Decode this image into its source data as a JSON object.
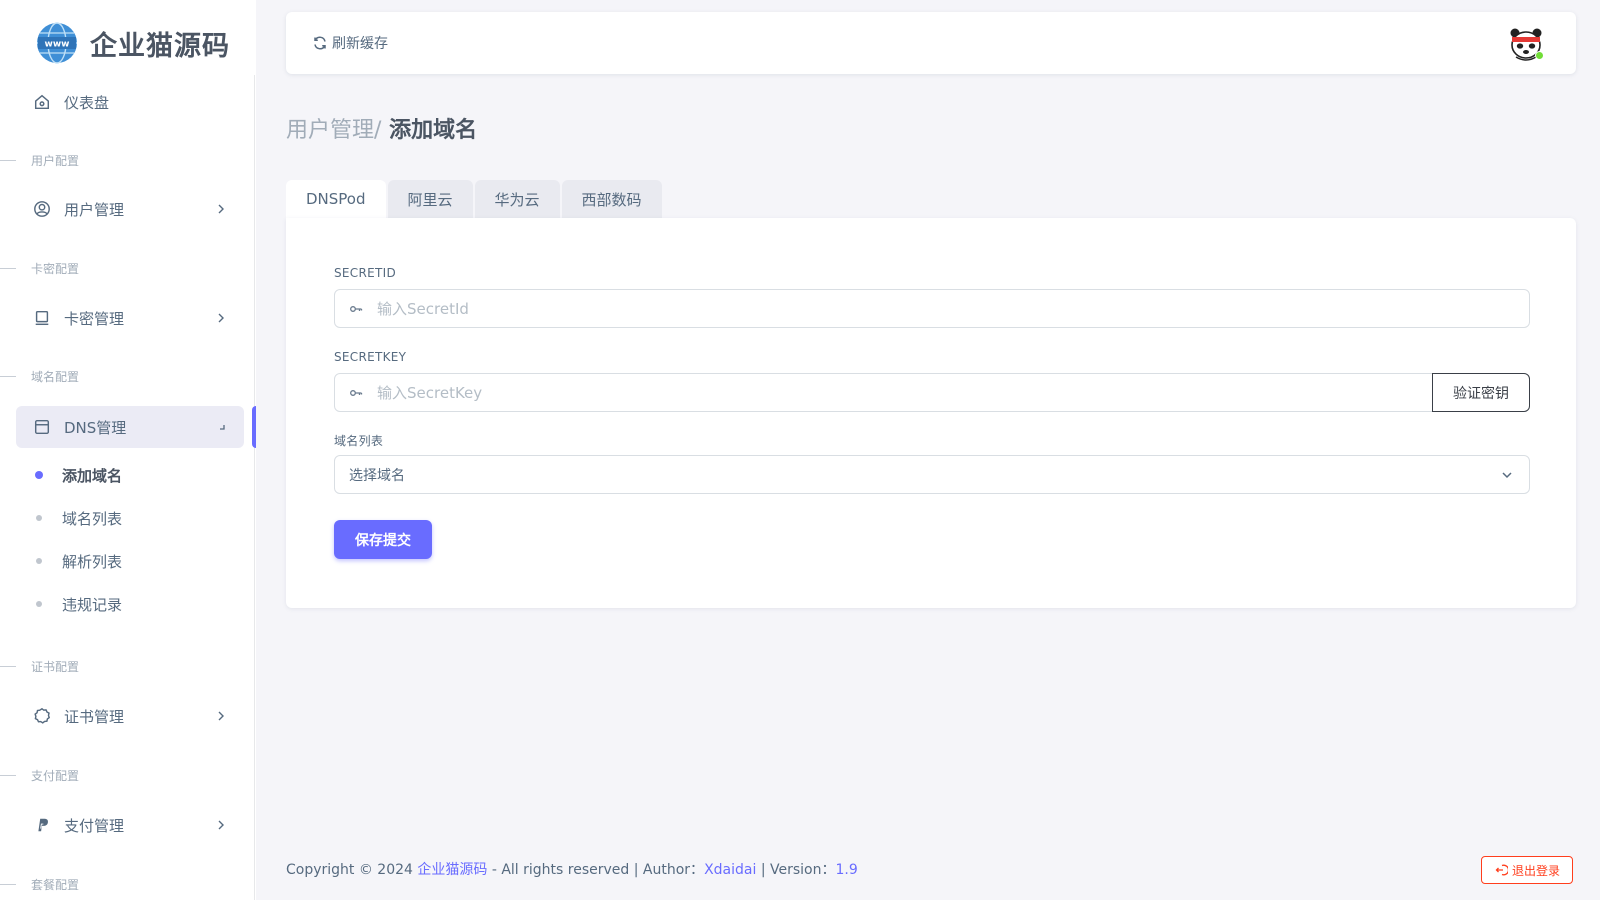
{
  "brand": {
    "name": "企业猫源码",
    "logo_icon": "globe-www-icon",
    "accent": "#3f8fd6"
  },
  "sidebar": {
    "dashboard": "仪表盘",
    "headers": [
      "用户配置",
      "卡密配置",
      "域名配置",
      "证书配置",
      "支付配置",
      "套餐配置"
    ],
    "user_mgmt": "用户管理",
    "card_mgmt": "卡密管理",
    "dns_mgmt": "DNS管理",
    "dns_sub": [
      "添加域名",
      "域名列表",
      "解析列表",
      "违规记录"
    ],
    "cert_mgmt": "证书管理",
    "pay_mgmt": "支付管理"
  },
  "topbar": {
    "refresh_label": "刷新缓存"
  },
  "page": {
    "breadcrumb_parent": "用户管理/",
    "title": "添加域名"
  },
  "tabs": [
    "DNSPod",
    "阿里云",
    "华为云",
    "西部数码"
  ],
  "form": {
    "secretid_label": "SECRETID",
    "secretid_placeholder": "输入SecretId",
    "secretkey_label": "SECRETKEY",
    "secretkey_placeholder": "输入SecretKey",
    "verify_label": "验证密钥",
    "domain_list_label": "域名列表",
    "domain_select_value": "选择域名",
    "submit_label": "保存提交"
  },
  "footer": {
    "prefix": "Copyright © 2024 ",
    "site_link": "企业猫源码",
    "middle": " - All rights reserved | Author：",
    "author": "Xdaidai",
    "version_prefix": " | Version：",
    "version": "1.9",
    "logout_label": "退出登录"
  },
  "colors": {
    "primary": "#696cff",
    "danger": "#ff3e1d",
    "online": "#71dd37"
  }
}
